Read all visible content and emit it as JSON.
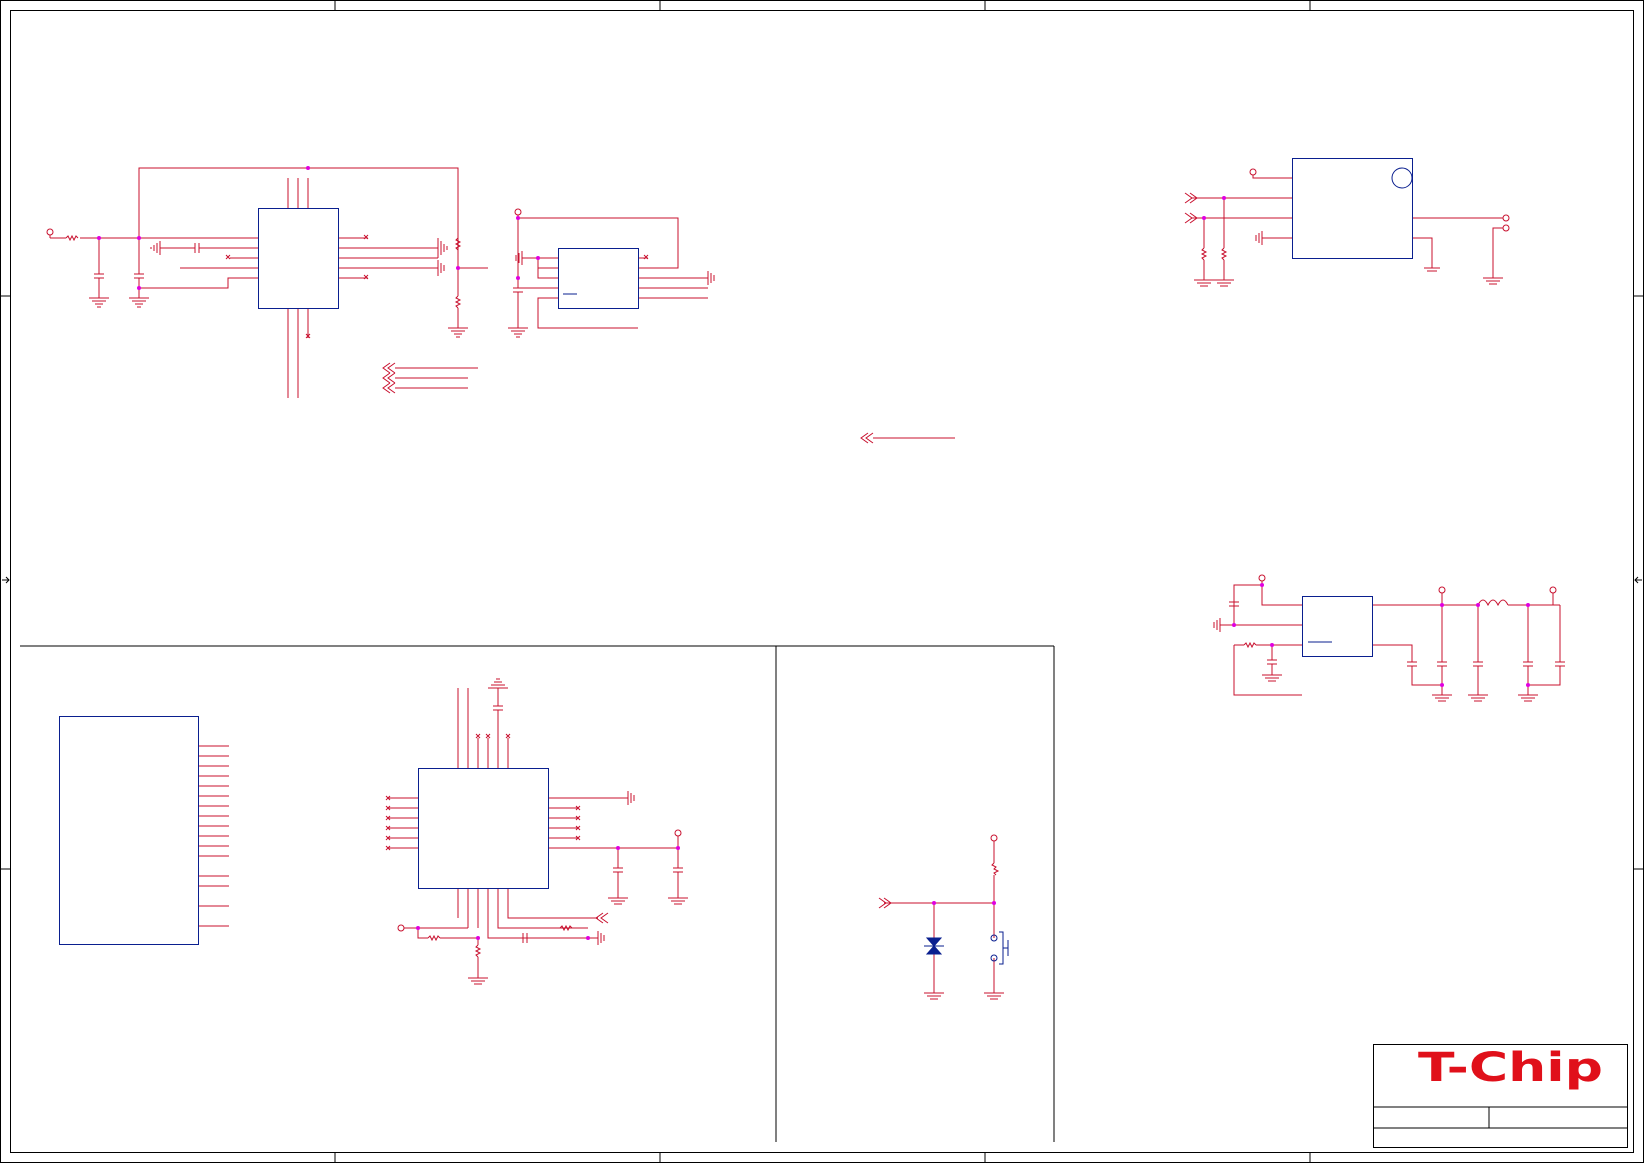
{
  "colors": {
    "wire": "#c8102e",
    "component": "#0a1f8f",
    "junction": "#e000e0",
    "frame": "#000000",
    "logo": "#e0101a",
    "background": "#ffffff"
  },
  "title_block": {
    "logo_text": "T-Chip"
  },
  "schematic": {
    "icons": [
      "ground-symbol",
      "power-port",
      "resistor",
      "capacitor",
      "inductor",
      "tvs-diode",
      "push-button",
      "off-sheet-connector",
      "no-connect-mark",
      "junction-dot"
    ]
  }
}
